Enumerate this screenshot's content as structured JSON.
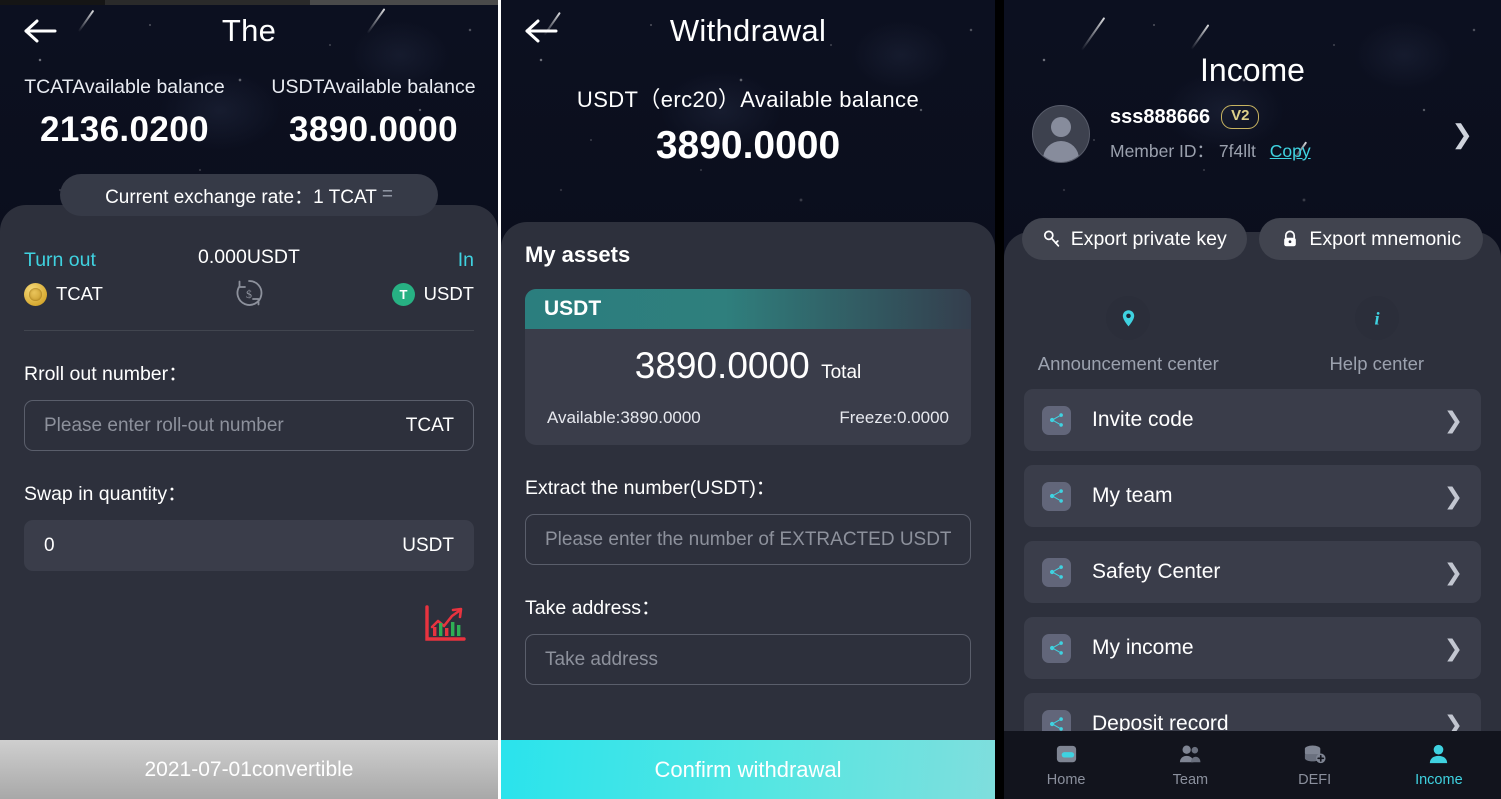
{
  "panel1": {
    "header": {
      "back_icon": "back-arrow-icon",
      "title": "The"
    },
    "balances": [
      {
        "label": "TCATAvailable balance",
        "value": "2136.0200"
      },
      {
        "label": "USDTAvailable balance",
        "value": "3890.0000"
      }
    ],
    "rate_pill": {
      "text": "Current exchange rate：1 TCAT",
      "equals": "="
    },
    "swap": {
      "from_label": "Turn out",
      "to_label": "In",
      "mid_amount": "0.000USDT",
      "from_coin": "TCAT",
      "to_coin": "USDT",
      "swap_icon": "swap-arrows-icon"
    },
    "roll_out": {
      "label": "Rroll out number：",
      "placeholder": "Please enter roll-out number",
      "value": "",
      "unit": "TCAT"
    },
    "swap_in": {
      "label": "Swap in quantity：",
      "placeholder": "",
      "value": "0",
      "unit": "USDT"
    },
    "chart_icon": "market-chart-icon",
    "bottom_cta": "2021-07-01convertible"
  },
  "panel2": {
    "header": {
      "back_icon": "back-arrow-icon",
      "title": "Withdrawal"
    },
    "balance_label": "USDT（erc20）Available balance",
    "balance_value": "3890.0000",
    "section_title": "My assets",
    "asset": {
      "symbol": "USDT",
      "total_value": "3890.0000",
      "total_label": "Total",
      "available": "Available:3890.0000",
      "freeze": "Freeze:0.0000"
    },
    "extract": {
      "label": "Extract the number(USDT)：",
      "placeholder": "Please enter the number of EXTRACTED USDT",
      "value": ""
    },
    "address": {
      "label": "Take address：",
      "placeholder": "Take address",
      "value": ""
    },
    "bottom_cta": "Confirm withdrawal"
  },
  "panel3": {
    "title": "Income",
    "profile": {
      "avatar_icon": "avatar-icon",
      "name": "sss888666",
      "level_badge": "V2",
      "member_id_label": "Member ID：",
      "member_id": "7f4llt",
      "copy_label": "Copy",
      "chevron_icon": "chevron-right-icon"
    },
    "export_buttons": [
      {
        "label": "Export private key",
        "icon": "key-icon"
      },
      {
        "label": "Export mnemonic",
        "icon": "lock-icon"
      }
    ],
    "centers": [
      {
        "label": "Announcement center",
        "icon": "location-pin-icon"
      },
      {
        "label": "Help center",
        "icon": "info-icon"
      }
    ],
    "menu": [
      {
        "label": "Invite code",
        "icon": "share-network-icon"
      },
      {
        "label": "My team",
        "icon": "share-network-icon"
      },
      {
        "label": "Safety Center",
        "icon": "share-network-icon"
      },
      {
        "label": "My income",
        "icon": "share-network-icon"
      },
      {
        "label": "Deposit record",
        "icon": "share-network-icon"
      }
    ],
    "tabbar": [
      {
        "label": "Home",
        "icon": "home-icon",
        "active": false
      },
      {
        "label": "Team",
        "icon": "team-icon",
        "active": false
      },
      {
        "label": "DEFI",
        "icon": "defi-coins-icon",
        "active": false
      },
      {
        "label": "Income",
        "icon": "person-icon",
        "active": true
      }
    ]
  },
  "colors": {
    "accent_cyan": "#3fd2e0",
    "card_bg": "#2d303c",
    "field_bg": "#3a3d4a",
    "usdt_green": "#27b183",
    "badge_gold": "#ddd08a",
    "chart_red": "#e8333f"
  }
}
